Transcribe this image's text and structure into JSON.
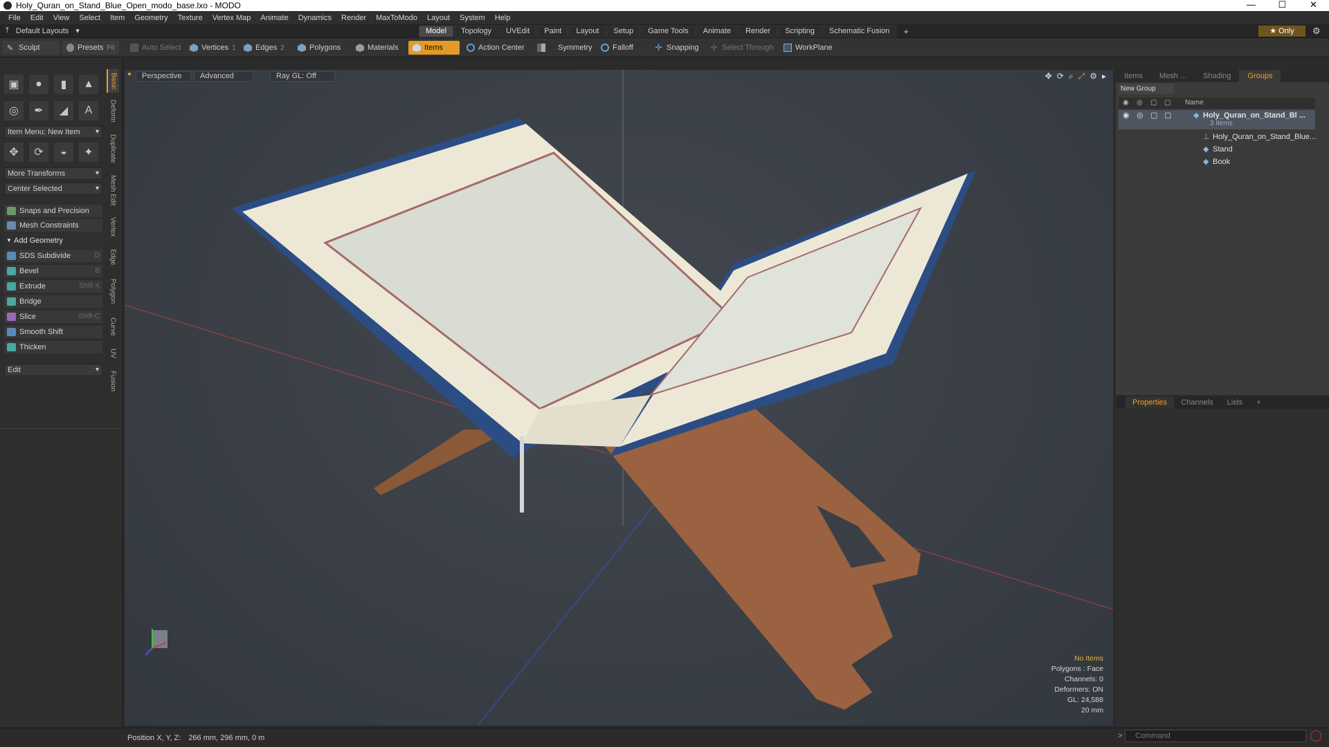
{
  "window": {
    "title": "Holy_Quran_on_Stand_Blue_Open_modo_base.lxo - MODO",
    "controls": [
      "—",
      "☐",
      "✕"
    ]
  },
  "menu": [
    "File",
    "Edit",
    "View",
    "Select",
    "Item",
    "Geometry",
    "Texture",
    "Vertex Map",
    "Animate",
    "Dynamics",
    "Render",
    "MaxToModo",
    "Layout",
    "System",
    "Help"
  ],
  "layoutbar": {
    "layout_label": "Default Layouts",
    "tabs": [
      "Model",
      "Topology",
      "UVEdit",
      "Paint",
      "Layout",
      "Setup",
      "Game Tools",
      "Animate",
      "Render",
      "Scripting",
      "Schematic Fusion"
    ],
    "active_tab": "Model",
    "add_label": "+",
    "only_label": "★  Only"
  },
  "toolbar": {
    "sculpt": "Sculpt",
    "presets": "Presets",
    "presets_key": "F6",
    "auto_select": "Auto Select",
    "vertices": "Vertices",
    "vertices_count": "1",
    "edges": "Edges",
    "edges_count": "2",
    "polygons": "Polygons",
    "materials": "Materials",
    "items": "Items",
    "action_center": "Action Center",
    "symmetry": "Symmetry",
    "falloff": "Falloff",
    "snapping": "Snapping",
    "select_through": "Select Through",
    "workplane": "WorkPlane"
  },
  "leftpanel": {
    "item_menu": "Item Menu: New Item",
    "more_transforms": "More Transforms",
    "center_selected": "Center Selected",
    "snaps": "Snaps and Precision",
    "mesh_constraints": "Mesh Constraints",
    "add_geometry": "Add Geometry",
    "tools": [
      {
        "label": "SDS Subdivide",
        "key": "D"
      },
      {
        "label": "Bevel",
        "key": "B"
      },
      {
        "label": "Extrude",
        "key": "Shift-X"
      },
      {
        "label": "Bridge",
        "key": ""
      },
      {
        "label": "Slice",
        "key": "Shift-C"
      },
      {
        "label": "Smooth Shift",
        "key": ""
      },
      {
        "label": "Thicken",
        "key": ""
      }
    ],
    "edit_dropdown": "Edit",
    "vertical_tabs": [
      "Basic",
      "Deform",
      "Duplicate",
      "Mesh Edit",
      "Vertex",
      "Edge",
      "Polygon",
      "Curve",
      "UV",
      "Fusion"
    ]
  },
  "viewport": {
    "view_mode": "Perspective",
    "advanced": "Advanced",
    "raygl": "Ray GL: Off",
    "stats": {
      "no_items": "No Items",
      "polygons": "Polygons : Face",
      "channels": "Channels: 0",
      "deformers": "Deformers: ON",
      "gl": "GL: 24,588",
      "scale": "20 mm"
    }
  },
  "statusbar": {
    "position_label": "Position X, Y, Z:",
    "position_value": "266 mm, 296 mm, 0 m",
    "command_placeholder": "Command"
  },
  "rightpanel": {
    "tabs": [
      "Items",
      "Mesh ...",
      "Shading",
      "Groups"
    ],
    "active_tab": "Groups",
    "new_group": "New Group",
    "name_col": "Name",
    "group_name": "Holy_Quran_on_Stand_Bl ...",
    "group_count": "3 Items",
    "children": [
      "Holy_Quran_on_Stand_Blue...",
      "Stand",
      "Book"
    ]
  },
  "bottompanel": {
    "tabs": [
      "Properties",
      "Channels",
      "Lists",
      "+"
    ],
    "active_tab": "Properties"
  }
}
